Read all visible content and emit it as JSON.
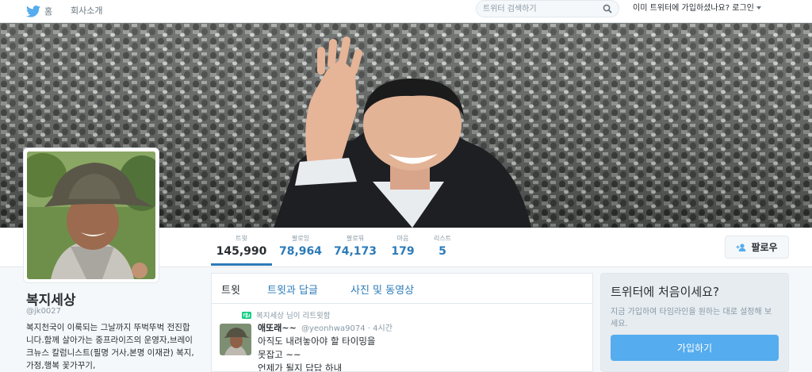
{
  "nav": {
    "home_label": "홈",
    "about_label": "회사소개",
    "search_placeholder": "트위터 검색하기",
    "login_text": "이미 트위터에 가입하셨나요? 로그인"
  },
  "profile": {
    "name": "복지세상",
    "handle": "@jk0027",
    "bio": "복지천국이 이룩되는 그날까지 뚜벅뚜벅 전진합니다.함께 살아가는 중프라이즈의 운영자,브레이크뉴스 칼럼니스트(필명 거사,본명 이재관) 복지,가정,행복 꽃가꾸기,"
  },
  "stats": [
    {
      "label": "트윗",
      "value": "145,990"
    },
    {
      "label": "팔로잉",
      "value": "78,964"
    },
    {
      "label": "팔로워",
      "value": "74,173"
    },
    {
      "label": "마음",
      "value": "179"
    },
    {
      "label": "리스트",
      "value": "5"
    }
  ],
  "follow_button": "팔로우",
  "tabs": [
    "트윗",
    "트윗과 답글",
    "사진 및 동영상"
  ],
  "tweet": {
    "retweet_context": "복지세상 님이 리트윗함",
    "author_name": "애또래~~",
    "author_handle": "@yeonhwa9074",
    "time": "· 4시간",
    "text": "아직도 내려놓아야 할 타이밍을\n못잡고 ~~\n언제가 될지 답답 하내"
  },
  "signup": {
    "title": "트위터에 처음이세요?",
    "description": "지금 가입하여 타임라인을 원하는 대로 설정해 보세요.",
    "button": "가입하기"
  },
  "colors": {
    "accent": "#2b7bb9",
    "signup_button": "#55acee",
    "bird": "#55acee"
  },
  "icons": [
    "bird-icon",
    "search-icon",
    "add-user-icon",
    "retweet-icon"
  ]
}
